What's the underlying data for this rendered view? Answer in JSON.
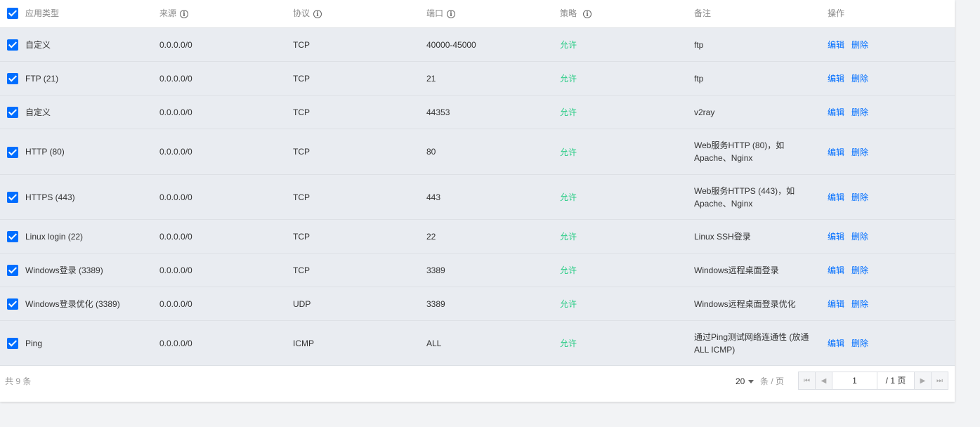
{
  "header": {
    "app_type": "应用类型",
    "source": "来源",
    "protocol": "协议",
    "port": "端口",
    "policy": "策略",
    "note": "备注",
    "action": "操作"
  },
  "rows": [
    {
      "app_type": "自定义",
      "source": "0.0.0.0/0",
      "protocol": "TCP",
      "port": "40000-45000",
      "policy": "允许",
      "note": "ftp",
      "edit": "编辑",
      "delete": "删除",
      "checked": true
    },
    {
      "app_type": "FTP (21)",
      "source": "0.0.0.0/0",
      "protocol": "TCP",
      "port": "21",
      "policy": "允许",
      "note": "ftp",
      "edit": "编辑",
      "delete": "删除",
      "checked": true
    },
    {
      "app_type": "自定义",
      "source": "0.0.0.0/0",
      "protocol": "TCP",
      "port": "44353",
      "policy": "允许",
      "note": "v2ray",
      "edit": "编辑",
      "delete": "删除",
      "checked": true
    },
    {
      "app_type": "HTTP (80)",
      "source": "0.0.0.0/0",
      "protocol": "TCP",
      "port": "80",
      "policy": "允许",
      "note": "Web服务HTTP (80)，如Apache、Nginx",
      "edit": "编辑",
      "delete": "删除",
      "checked": true
    },
    {
      "app_type": "HTTPS (443)",
      "source": "0.0.0.0/0",
      "protocol": "TCP",
      "port": "443",
      "policy": "允许",
      "note": "Web服务HTTPS (443)，如Apache、Nginx",
      "edit": "编辑",
      "delete": "删除",
      "checked": true
    },
    {
      "app_type": "Linux login (22)",
      "source": "0.0.0.0/0",
      "protocol": "TCP",
      "port": "22",
      "policy": "允许",
      "note": "Linux SSH登录",
      "edit": "编辑",
      "delete": "删除",
      "checked": true
    },
    {
      "app_type": "Windows登录 (3389)",
      "source": "0.0.0.0/0",
      "protocol": "TCP",
      "port": "3389",
      "policy": "允许",
      "note": "Windows远程桌面登录",
      "edit": "编辑",
      "delete": "删除",
      "checked": true
    },
    {
      "app_type": "Windows登录优化 (3389)",
      "source": "0.0.0.0/0",
      "protocol": "UDP",
      "port": "3389",
      "policy": "允许",
      "note": "Windows远程桌面登录优化",
      "edit": "编辑",
      "delete": "删除",
      "checked": true
    },
    {
      "app_type": "Ping",
      "source": "0.0.0.0/0",
      "protocol": "ICMP",
      "port": "ALL",
      "policy": "允许",
      "note": "通过Ping测试网络连通性 (放通ALL ICMP)",
      "edit": "编辑",
      "delete": "删除",
      "checked": true
    }
  ],
  "footer": {
    "total": "共 9 条",
    "page_size": "20",
    "per_page": "条 / 页",
    "current_page": "1",
    "total_pages": "/ 1 页"
  },
  "colors": {
    "accent": "#006eff",
    "allow": "#29cc85",
    "row_bg": "#e9ecf1"
  }
}
